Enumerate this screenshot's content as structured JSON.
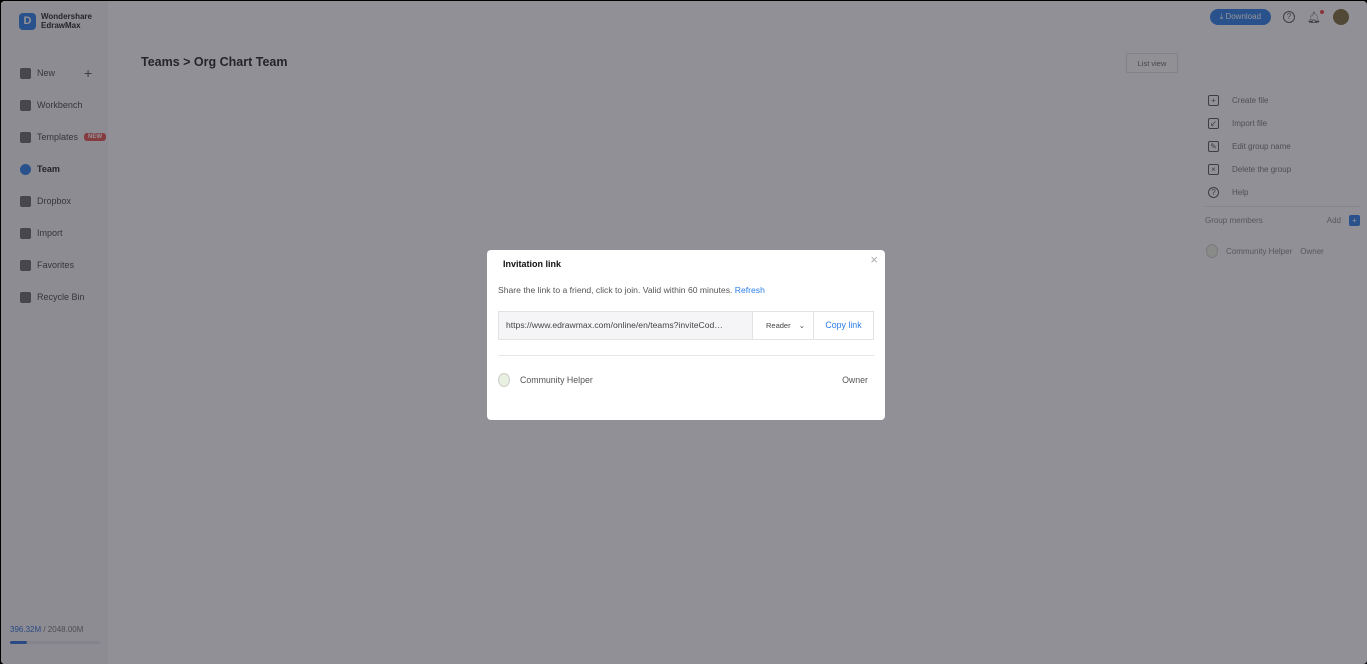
{
  "brand": {
    "line1": "Wondershare",
    "line2": "EdrawMax"
  },
  "sidebar": {
    "items": [
      {
        "label": "New",
        "icon": "plus-square-icon"
      },
      {
        "label": "Workbench",
        "icon": "cloud-icon"
      },
      {
        "label": "Templates",
        "icon": "templates-icon",
        "badge": "NEW"
      },
      {
        "label": "Team",
        "icon": "team-icon",
        "active": true
      },
      {
        "label": "Dropbox",
        "icon": "dropbox-icon"
      },
      {
        "label": "Import",
        "icon": "import-icon"
      },
      {
        "label": "Favorites",
        "icon": "heart-icon"
      },
      {
        "label": "Recycle Bin",
        "icon": "trash-icon"
      }
    ],
    "storage": {
      "used": "396.32M",
      "total": " / 2048.00M",
      "fraction": 0.19
    }
  },
  "header": {
    "breadcrumb": "Teams > Org Chart Team",
    "list_view": "List view",
    "download": "Download"
  },
  "actions": [
    "Create file",
    "Import file",
    "Edit group name",
    "Delete the group",
    "Help"
  ],
  "group": {
    "label": "Group members",
    "add": "Add",
    "member": "Community Helper",
    "role": "Owner"
  },
  "modal": {
    "title": "Invitation link",
    "desc": "Share the link to a friend, click to join. Valid within 60 minutes.",
    "refresh": "Refresh",
    "url": "https://www.edrawmax.com/online/en/teams?inviteCod…",
    "permission": "Reader",
    "copy": "Copy link",
    "member": "Community Helper",
    "role": "Owner"
  },
  "colors": {
    "accent": "#2b7de9",
    "badge": "#e25353"
  }
}
